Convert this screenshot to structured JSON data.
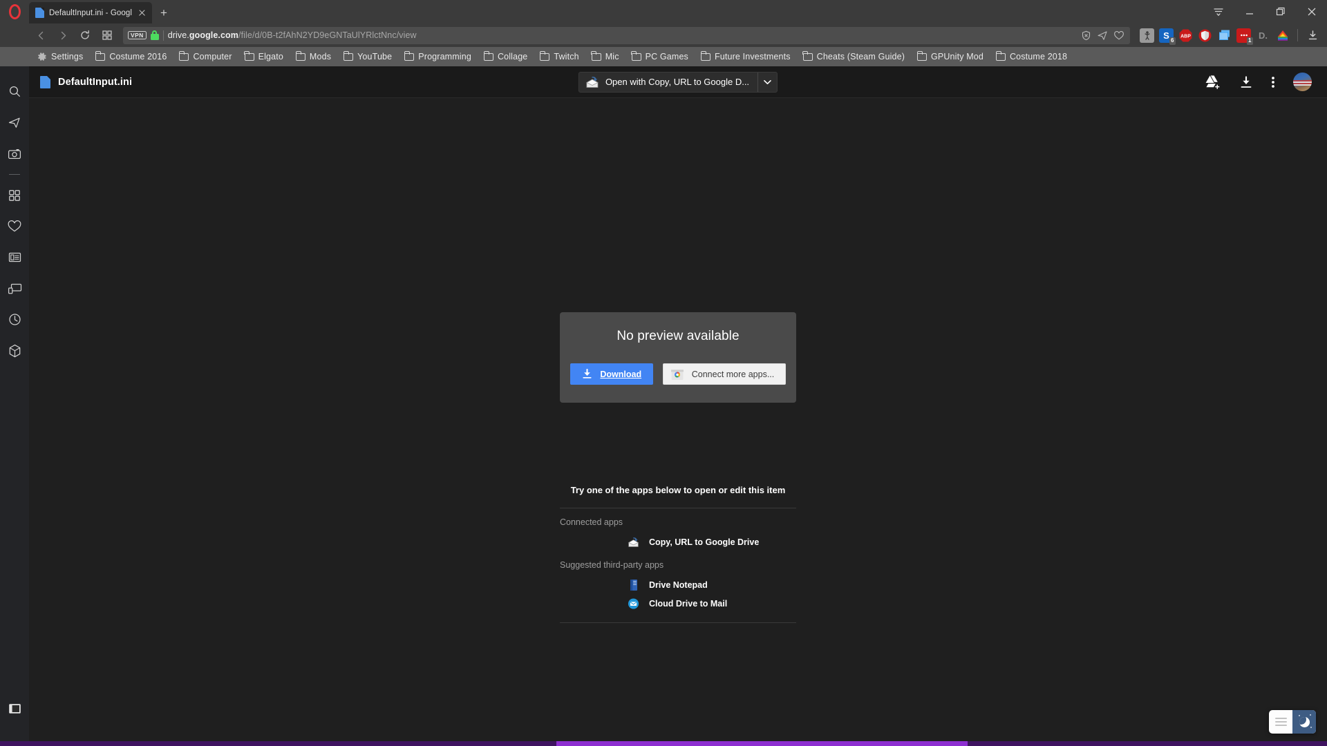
{
  "browser": {
    "name": "Opera",
    "tab": {
      "title": "DefaultInput.ini - Google D",
      "favicon": "file-icon",
      "close_icon": "close-icon"
    },
    "new_tab_label": "+",
    "nav": {
      "back_icon": "back-arrow-icon",
      "forward_icon": "forward-arrow-icon",
      "reload_icon": "reload-icon",
      "speeddial_icon": "grid-icon"
    },
    "address": {
      "vpn_badge": "VPN",
      "lock_icon": "lock-icon",
      "url_host": "drive.google.com",
      "url_host_bold": "google.com",
      "url_host_prefix": "drive.",
      "url_path": "/file/d/0B-t2fAhN2YD9eGNTaUlYRlctNnc/view",
      "full_url": "drive.google.com/file/d/0B-t2fAhN2YD9eGNTaUlYRlctNnc/view",
      "right_icons": [
        "ad-block-shield-icon",
        "send-icon",
        "heart-icon"
      ]
    },
    "extensions": [
      {
        "name": "tampermonkey-icon",
        "label": "",
        "badge": "",
        "color": "#9a9a9a"
      },
      {
        "name": "s-extension-icon",
        "label": "S",
        "badge": "6",
        "color": "#1a73c7"
      },
      {
        "name": "adblock-plus-icon",
        "label": "ABP",
        "badge": "",
        "color": "#c62828"
      },
      {
        "name": "ublock-origin-icon",
        "label": "",
        "badge": "",
        "color": "#c62828"
      },
      {
        "name": "tab-manager-icon",
        "label": "",
        "badge": "",
        "color": "#4a9fe0"
      },
      {
        "name": "messenger-icon",
        "label": "",
        "badge": "1",
        "color": "#c62828"
      },
      {
        "name": "d-extension-icon",
        "label": "D.",
        "badge": "",
        "color": "#5a5a5a"
      },
      {
        "name": "rainbow-extension-icon",
        "label": "",
        "badge": "",
        "color": "#cf3a3a"
      }
    ],
    "downloads_icon": "download-tray-icon",
    "window_controls": {
      "menu_icon": "easy-setup-icon",
      "minimize_icon": "minimize-icon",
      "restore_icon": "restore-icon",
      "close_icon": "window-close-icon"
    },
    "bookmarks": [
      {
        "label": "Settings",
        "icon": "gear-icon"
      },
      {
        "label": "Costume 2016",
        "icon": "folder-icon"
      },
      {
        "label": "Computer",
        "icon": "folder-icon"
      },
      {
        "label": "Elgato",
        "icon": "folder-icon"
      },
      {
        "label": "Mods",
        "icon": "folder-icon"
      },
      {
        "label": "YouTube",
        "icon": "folder-icon"
      },
      {
        "label": "Programming",
        "icon": "folder-icon"
      },
      {
        "label": "Collage",
        "icon": "folder-icon"
      },
      {
        "label": "Twitch",
        "icon": "folder-icon"
      },
      {
        "label": "Mic",
        "icon": "folder-icon"
      },
      {
        "label": "PC Games",
        "icon": "folder-icon"
      },
      {
        "label": "Future Investments",
        "icon": "folder-icon"
      },
      {
        "label": "Cheats (Steam Guide)",
        "icon": "folder-icon"
      },
      {
        "label": "GPUnity Mod",
        "icon": "folder-icon"
      },
      {
        "label": "Costume 2018",
        "icon": "folder-icon"
      }
    ],
    "sidebar": [
      {
        "name": "sidebar-item-search",
        "icon": "search-icon"
      },
      {
        "name": "sidebar-item-messenger",
        "icon": "send-icon"
      },
      {
        "name": "sidebar-item-snapshot",
        "icon": "camera-icon"
      },
      {
        "name": "sidebar-item-extensions",
        "icon": "grid-icon"
      },
      {
        "name": "sidebar-item-favorites",
        "icon": "heart-icon"
      },
      {
        "name": "sidebar-item-news",
        "icon": "news-icon"
      },
      {
        "name": "sidebar-item-my-flow",
        "icon": "devices-icon"
      },
      {
        "name": "sidebar-item-history",
        "icon": "clock-icon"
      },
      {
        "name": "sidebar-item-player",
        "icon": "cube-icon"
      }
    ],
    "sidebar_toggle_icon": "panel-toggle-icon"
  },
  "drive": {
    "file_name": "DefaultInput.ini",
    "file_icon": "file-icon",
    "open_with": {
      "label": "Open with Copy, URL to Google D...",
      "icon": "copy-url-to-google-drive-icon",
      "dropdown_icon": "chevron-down-icon"
    },
    "header_actions": [
      {
        "name": "add-to-my-drive-button",
        "icon": "drive-plus-icon"
      },
      {
        "name": "download-button",
        "icon": "download-icon"
      },
      {
        "name": "more-actions-button",
        "icon": "kebab-menu-icon"
      }
    ],
    "avatar_name": "account-avatar",
    "no_preview": {
      "title": "No preview available",
      "download_label": "Download",
      "download_icon": "download-icon",
      "connect_label": "Connect more apps...",
      "connect_icon": "chrome-web-store-icon",
      "download_color": "#4285f4"
    },
    "apps_section": {
      "heading": "Try one of the apps below to open or edit this item",
      "connected_label": "Connected apps",
      "connected_apps": [
        {
          "name": "Copy, URL to Google Drive",
          "icon": "copy-url-to-google-drive-icon"
        }
      ],
      "suggested_label": "Suggested third-party apps",
      "suggested_apps": [
        {
          "name": "Drive Notepad",
          "icon": "drive-notepad-icon"
        },
        {
          "name": "Cloud Drive to Mail",
          "icon": "cloud-drive-to-mail-icon"
        }
      ]
    }
  },
  "overlay": {
    "dark_mode_widget": {
      "list_icon": "lines-icon",
      "night_icon": "moon-icon",
      "accent": "#3e5c83"
    }
  }
}
